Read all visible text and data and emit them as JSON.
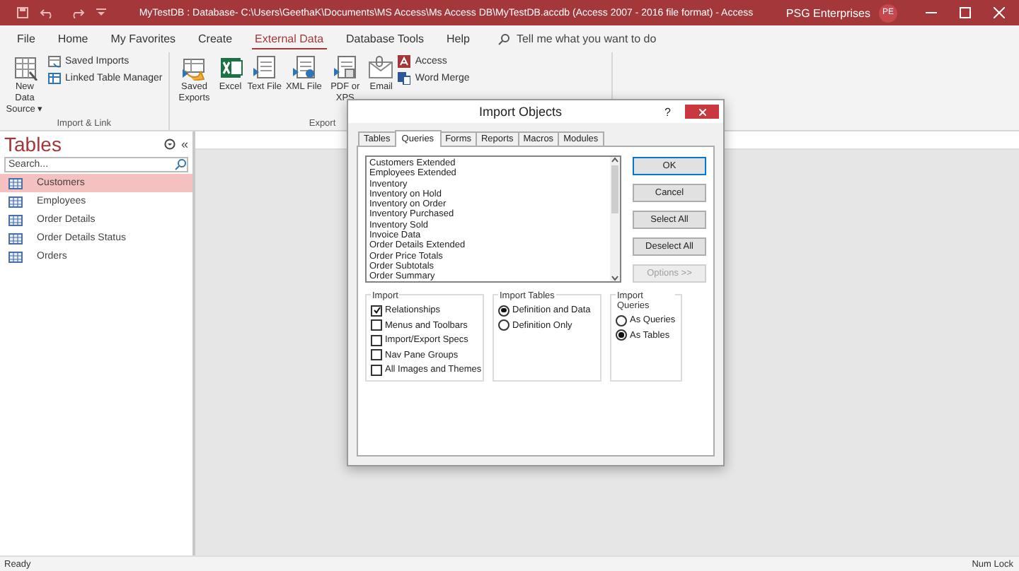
{
  "title_bar": {
    "title": "MyTestDB : Database- C:\\Users\\GeethaK\\Documents\\MS Access\\Ms Access DB\\MyTestDB.accdb (Access 2007 - 2016 file format)  -  Access",
    "account": "PSG Enterprises",
    "avatar": "PE"
  },
  "menu_tabs": [
    {
      "label": "File",
      "selected": false
    },
    {
      "label": "Home",
      "selected": false
    },
    {
      "label": "My Favorites",
      "selected": false
    },
    {
      "label": "Create",
      "selected": false
    },
    {
      "label": "External Data",
      "selected": true
    },
    {
      "label": "Database Tools",
      "selected": false
    },
    {
      "label": "Help",
      "selected": false
    }
  ],
  "tell_me": {
    "placeholder": "Tell me what you want to do"
  },
  "ribbon_groups": [
    {
      "label": "Import & Link",
      "items": [
        {
          "kind": "large",
          "label": "New Data Source ▾"
        },
        {
          "kind": "small",
          "label": "Saved Imports"
        },
        {
          "kind": "small",
          "label": "Linked Table Manager"
        }
      ]
    },
    {
      "label": "Export",
      "items": [
        {
          "kind": "large",
          "label": "Saved Exports"
        },
        {
          "kind": "large",
          "label": "Excel"
        },
        {
          "kind": "large",
          "label": "Text File"
        },
        {
          "kind": "large",
          "label": "XML File"
        },
        {
          "kind": "large",
          "label": "PDF or XPS"
        },
        {
          "kind": "large",
          "label": "Email"
        },
        {
          "kind": "small",
          "label": "Access"
        },
        {
          "kind": "small",
          "label": "Word Merge"
        }
      ]
    }
  ],
  "nav_pane": {
    "title": "Tables",
    "collapse": "«",
    "search": {
      "placeholder": "Search..."
    },
    "items": [
      {
        "label": "Customers",
        "selected": true
      },
      {
        "label": "Employees",
        "selected": false
      },
      {
        "label": "Order Details",
        "selected": false
      },
      {
        "label": "Order Details Status",
        "selected": false
      },
      {
        "label": "Orders",
        "selected": false
      }
    ]
  },
  "dialog": {
    "title": "Import Objects",
    "help": "?",
    "tabs": [
      {
        "label": "Tables",
        "selected": false
      },
      {
        "label": "Queries",
        "selected": true
      },
      {
        "label": "Forms",
        "selected": false
      },
      {
        "label": "Reports",
        "selected": false
      },
      {
        "label": "Macros",
        "selected": false
      },
      {
        "label": "Modules",
        "selected": false
      }
    ],
    "list": [
      "Customers Extended",
      "Employees Extended",
      "Inventory",
      "Inventory on Hold",
      "Inventory on Order",
      "Inventory Purchased",
      "Inventory Sold",
      "Invoice Data",
      "Order Details Extended",
      "Order Price Totals",
      "Order Subtotals",
      "Order Summary"
    ],
    "buttons": [
      {
        "label": "OK",
        "disabled": false
      },
      {
        "label": "Cancel",
        "disabled": false
      },
      {
        "label": "Select All",
        "disabled": false
      },
      {
        "label": "Deselect All",
        "disabled": false
      },
      {
        "label": "Options >>",
        "disabled": true
      }
    ],
    "groups": [
      {
        "title": "Import",
        "kind": "checkbox",
        "options": [
          {
            "label": "Relationships",
            "checked": true
          },
          {
            "label": "Menus and Toolbars",
            "checked": false
          },
          {
            "label": "Import/Export Specs",
            "checked": false
          },
          {
            "label": "Nav Pane Groups",
            "checked": false
          },
          {
            "label": "All Images and Themes",
            "checked": false
          }
        ]
      },
      {
        "title": "Import Tables",
        "kind": "radio",
        "options": [
          {
            "label": "Definition and Data",
            "checked": true
          },
          {
            "label": "Definition Only",
            "checked": false
          }
        ]
      },
      {
        "title": "Import Queries",
        "kind": "radio",
        "options": [
          {
            "label": "As Queries",
            "checked": false
          },
          {
            "label": "As Tables",
            "checked": true
          }
        ]
      }
    ]
  },
  "status_bar": {
    "left": "Ready",
    "right": "Num Lock"
  }
}
